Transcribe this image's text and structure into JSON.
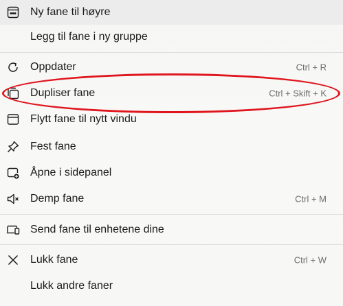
{
  "menu": {
    "items": [
      {
        "label": "Ny fane til høyre",
        "shortcut": ""
      },
      {
        "label": "Legg til fane i ny gruppe",
        "shortcut": ""
      },
      {
        "label": "Oppdater",
        "shortcut": "Ctrl + R"
      },
      {
        "label": "Dupliser fane",
        "shortcut": "Ctrl + Skift + K"
      },
      {
        "label": "Flytt fane til nytt vindu",
        "shortcut": ""
      },
      {
        "label": "Fest fane",
        "shortcut": ""
      },
      {
        "label": "Åpne i sidepanel",
        "shortcut": ""
      },
      {
        "label": "Demp fane",
        "shortcut": "Ctrl + M"
      },
      {
        "label": "Send fane til enhetene dine",
        "shortcut": ""
      },
      {
        "label": "Lukk fane",
        "shortcut": "Ctrl + W"
      },
      {
        "label": "Lukk andre faner",
        "shortcut": ""
      }
    ]
  },
  "annotation": {
    "color": "#e0161e"
  }
}
